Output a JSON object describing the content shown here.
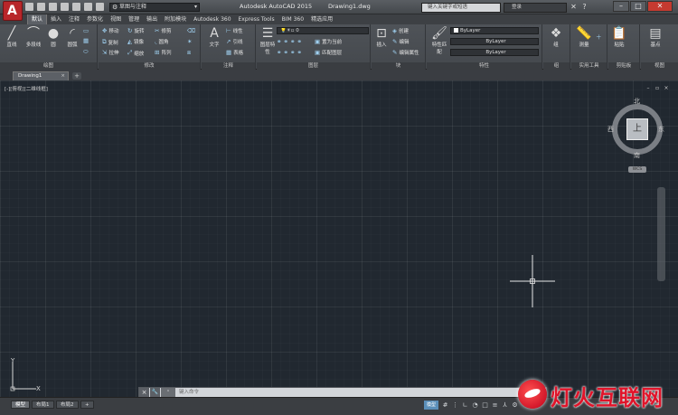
{
  "titlebar": {
    "workspace": "草图与注释",
    "app_title": "Autodesk AutoCAD 2015",
    "doc_title": "Drawing1.dwg",
    "search_placeholder": "键入关键字或短语",
    "signin": "登录",
    "app_logo_letter": "A"
  },
  "ribbon_tabs": [
    "默认",
    "插入",
    "注释",
    "参数化",
    "视图",
    "管理",
    "输出",
    "附加模块",
    "Autodesk 360",
    "Express Tools",
    "BIM 360",
    "精选应用"
  ],
  "ribbon": {
    "draw": {
      "title": "绘图",
      "line": "直线",
      "polyline": "多段线",
      "circle": "圆",
      "arc": "圆弧"
    },
    "modify": {
      "title": "修改",
      "move": "移动",
      "rotate": "旋转",
      "trim": "修剪",
      "copy": "复制",
      "mirror": "镜像",
      "fillet": "圆角",
      "stretch": "拉伸",
      "scale": "缩放",
      "array": "阵列"
    },
    "annotation": {
      "title": "注释",
      "text": "文字",
      "linear": "线性",
      "leader": "引线",
      "table": "表格"
    },
    "layers": {
      "title": "图层",
      "layer_props": "图层特性",
      "layer_combo": "0",
      "make_current": "置为当前",
      "match_layer": "匹配图层"
    },
    "block": {
      "title": "块",
      "insert": "插入",
      "create": "创建",
      "edit": "编辑",
      "edit_attr": "编辑属性"
    },
    "properties": {
      "title": "特性",
      "match": "特性匹配",
      "color": "ByLayer",
      "linetype": "ByLayer",
      "lineweight": "ByLayer"
    },
    "groups": {
      "title": "组",
      "group": "组"
    },
    "utilities": {
      "title": "实用工具",
      "measure": "测量"
    },
    "clipboard": {
      "title": "剪贴板",
      "paste": "粘贴"
    },
    "view": {
      "title": "视图",
      "base": "基点"
    }
  },
  "file_tabs": {
    "drawing1": "Drawing1",
    "close": "×",
    "new": "+"
  },
  "viewport": {
    "label": "[-][俯视][二维线框]",
    "compass": {
      "north": "北",
      "south": "南",
      "east": "东",
      "west": "西"
    },
    "cube_face": "上",
    "wcs": "WCS",
    "ucs_x": "X",
    "ucs_y": "Y"
  },
  "command_line": {
    "placeholder": "键入命令",
    "close": "×",
    "customize": "🔧",
    "recent": "⌃"
  },
  "layout_tabs": [
    "模型",
    "布局1",
    "布局2"
  ],
  "status_bar": {
    "model_button": "模型"
  },
  "watermark": {
    "text": "灯火互联网"
  }
}
